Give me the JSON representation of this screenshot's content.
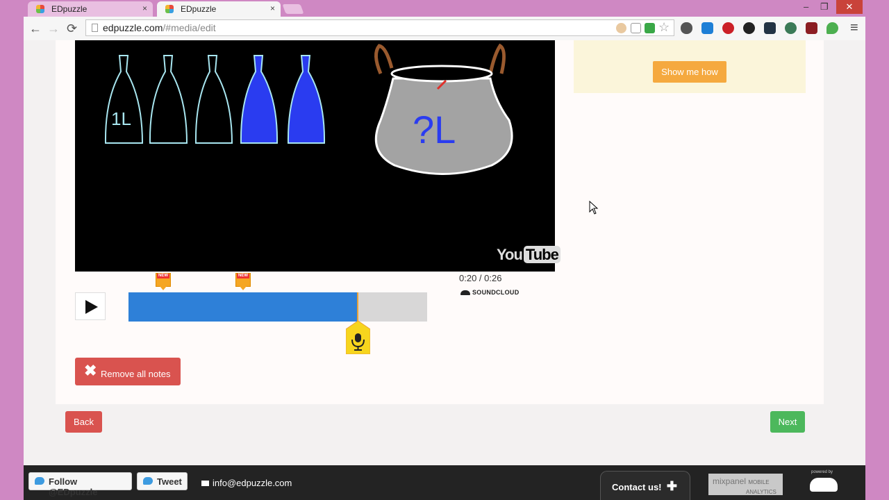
{
  "browser": {
    "tabs": [
      {
        "title": "EDpuzzle",
        "active": false
      },
      {
        "title": "EDpuzzle",
        "active": true
      }
    ],
    "close_glyph": "×",
    "url_host": "edpuzzle.com",
    "url_path": "/#media/edit",
    "window_controls": {
      "minimize": "–",
      "restore": "❐",
      "close": "✕"
    },
    "nav": {
      "back": "←",
      "forward": "→",
      "reload": "⟳",
      "menu": "≡"
    }
  },
  "hint": {
    "show_me_how_label": "Show me how"
  },
  "player": {
    "current_time": "0:20",
    "duration": "0:26",
    "time_display": "0:20 / 0:26",
    "progress_fraction": 0.7674,
    "notes_positions_seconds": [
      3,
      10
    ],
    "note_badge": "NEW",
    "source_label": "SOUNDCLOUD",
    "youtube_you": "You",
    "youtube_tube": "Tube"
  },
  "video": {
    "bottle_label": "1L",
    "pot_label": "?L"
  },
  "actions": {
    "remove_notes_label": "Remove all notes",
    "back_label": "Back",
    "next_label": "Next"
  },
  "footer": {
    "follow_label": "Follow @EDpuzzle",
    "tweet_label": "Tweet",
    "email": "info@edpuzzle.com",
    "contact_label": "Contact us!",
    "mixpanel_label": "mixpanel",
    "mixpanel_sub1": "MOBILE",
    "mixpanel_sub2": "ANALYTICS",
    "powered_by": "powered by"
  },
  "colors": {
    "frame": "#cf88c3",
    "progress": "#2e80d8",
    "accent_orange": "#f5a93f",
    "danger": "#d9534f",
    "success": "#4cb85c",
    "footer": "#232323"
  },
  "icons": [
    "back-arrow-icon",
    "forward-arrow-icon",
    "reload-icon",
    "page-icon",
    "star-icon",
    "menu-icon",
    "play-icon",
    "microphone-icon",
    "close-x-icon",
    "twitter-bird-icon",
    "envelope-icon",
    "plus-icon",
    "soundcloud-icon",
    "cursor-icon"
  ]
}
